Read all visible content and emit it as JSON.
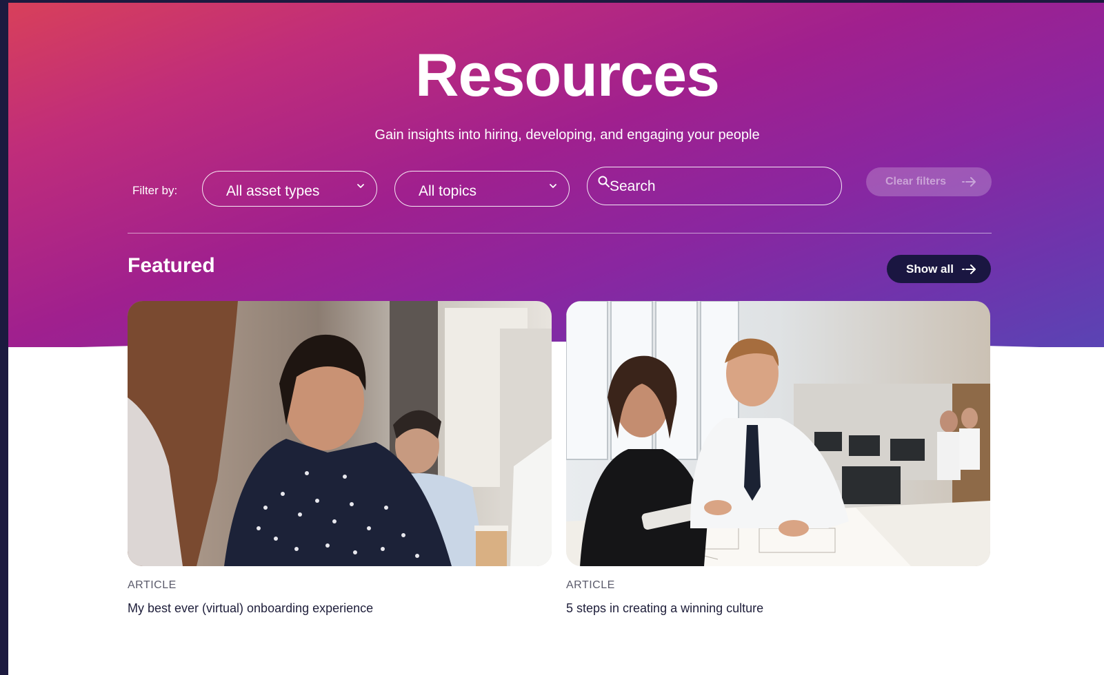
{
  "hero": {
    "title": "Resources",
    "subtitle": "Gain insights into hiring, developing, and engaging your people"
  },
  "filters": {
    "label": "Filter by:",
    "asset_type": {
      "selected": "All asset types"
    },
    "topic": {
      "selected": "All topics"
    },
    "search": {
      "placeholder": "Search",
      "value": ""
    },
    "clear_label": "Clear filters"
  },
  "featured": {
    "heading": "Featured",
    "show_all_label": "Show all",
    "cards": [
      {
        "type": "ARTICLE",
        "title": "My best ever (virtual) onboarding experience",
        "image": "office-women-smiling-photo"
      },
      {
        "type": "ARTICLE",
        "title": "5 steps in creating a winning culture",
        "image": "colleagues-reviewing-plans-photo"
      }
    ]
  },
  "colors": {
    "frame": "#1c1a3f",
    "gradient_start": "#d8405a",
    "gradient_mid": "#a0208e",
    "gradient_end": "#5a44b4",
    "show_all_bg": "#1a1641",
    "text_dark": "#1e1e3a"
  },
  "icons": [
    "chevron-down-icon",
    "search-icon",
    "arrow-right-icon"
  ]
}
